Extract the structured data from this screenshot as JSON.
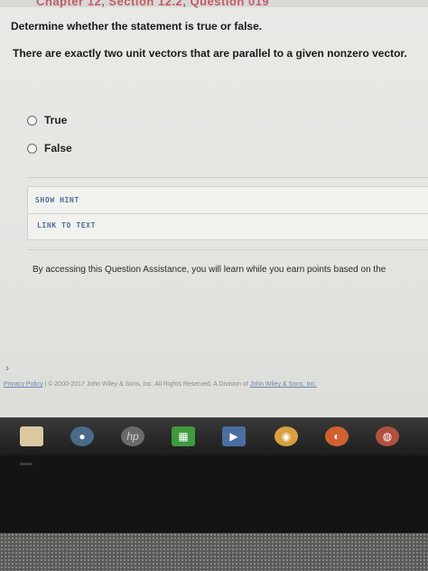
{
  "header": {
    "partial_title": "Chapter 12, Section 12.2, Question 019"
  },
  "question": {
    "instruction": "Determine whether the statement is true or false.",
    "statement": "There are exactly two unit vectors that are parallel to a given nonzero vector."
  },
  "options": [
    {
      "label": "True",
      "selected": false
    },
    {
      "label": "False",
      "selected": false
    }
  ],
  "buttons": {
    "show_hint": "SHOW HINT",
    "link_to_text": "LINK TO TEXT"
  },
  "assistance_text": "By accessing this Question Assistance, you will learn while you earn points based on the",
  "footer": {
    "privacy": "Privacy Policy",
    "separator": "|",
    "copyright": "© 2000-2017 John Wiley & Sons, Inc. All Rights Reserved. A Division of",
    "division_link": "John Wiley & Sons, Inc."
  },
  "taskbar": {
    "icons": [
      "file-explorer-icon",
      "media-icon",
      "hp-icon",
      "store-icon",
      "video-icon",
      "chrome-icon",
      "firefox-icon",
      "app-icon"
    ]
  }
}
